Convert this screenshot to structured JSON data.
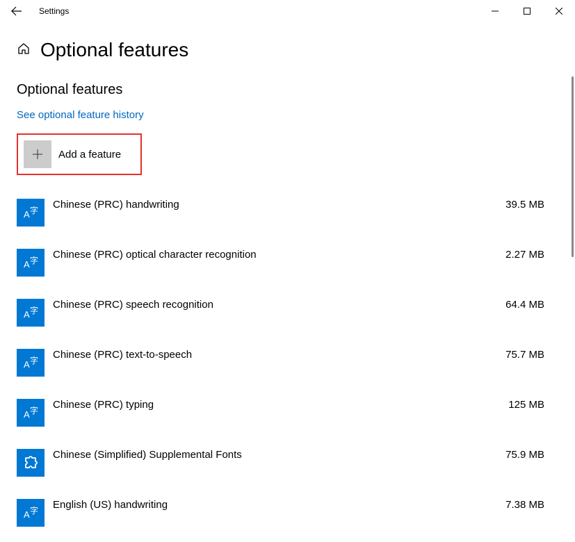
{
  "app_title": "Settings",
  "page_title": "Optional features",
  "section_title": "Optional features",
  "history_link": "See optional feature history",
  "add_feature_label": "Add a feature",
  "features": [
    {
      "name": "Chinese (PRC) handwriting",
      "size": "39.5 MB",
      "icon": "lang"
    },
    {
      "name": "Chinese (PRC) optical character recognition",
      "size": "2.27 MB",
      "icon": "lang"
    },
    {
      "name": "Chinese (PRC) speech recognition",
      "size": "64.4 MB",
      "icon": "lang"
    },
    {
      "name": "Chinese (PRC) text-to-speech",
      "size": "75.7 MB",
      "icon": "lang"
    },
    {
      "name": "Chinese (PRC) typing",
      "size": "125 MB",
      "icon": "lang"
    },
    {
      "name": "Chinese (Simplified) Supplemental Fonts",
      "size": "75.9 MB",
      "icon": "puzzle"
    },
    {
      "name": "English (US) handwriting",
      "size": "7.38 MB",
      "icon": "lang"
    }
  ]
}
